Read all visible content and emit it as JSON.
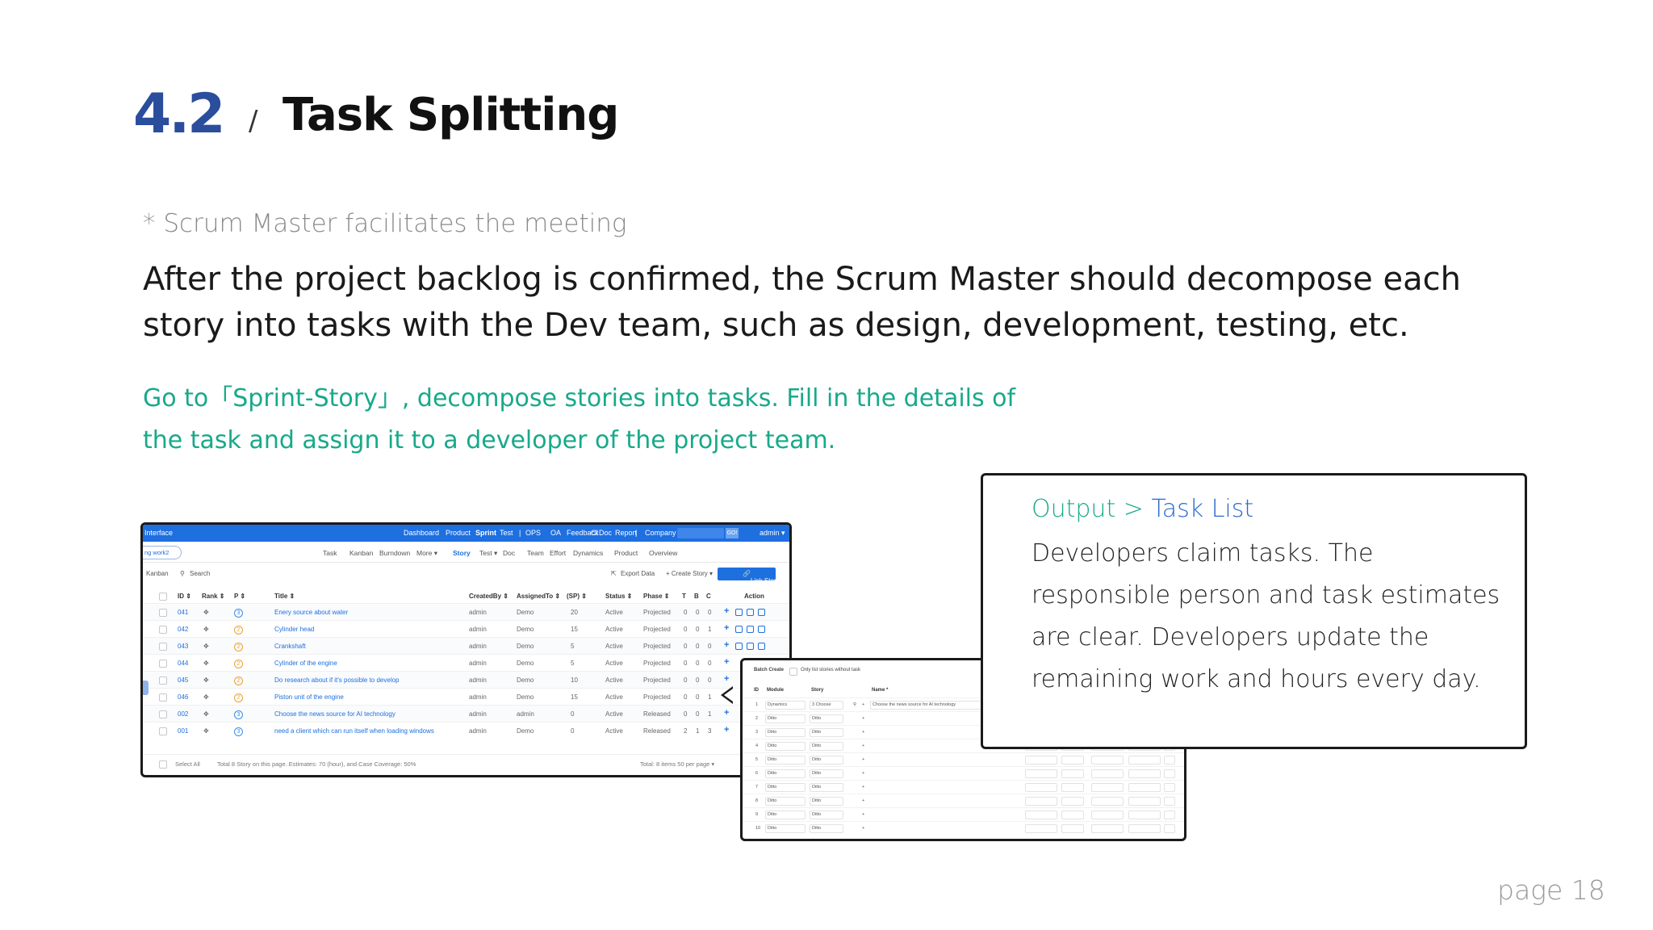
{
  "header": {
    "section_number": "4.2",
    "slash": "/",
    "title": "Task Splitting"
  },
  "note": "* Scrum Master facilitates the meeting",
  "lead": "After the project backlog is confirmed, the Scrum Master should decompose each story into tasks with the Dev team, such as design, development, testing, etc.",
  "instruction": "Go to「Sprint-Story」, decompose stories into tasks. Fill in the details of the task and assign it to a developer of the project team.",
  "callout": {
    "title_prefix": "Output >",
    "title_link": "Task List",
    "body": "Developers claim tasks. The responsible person and task estimates are clear. Developers update the remaining work and hours every day."
  },
  "page_number": "page 18",
  "app": {
    "topbar": {
      "brand": "Interface",
      "nav": [
        "Dashboard",
        "Product",
        "Sprint",
        "Test",
        "|",
        "OPS",
        "OA",
        "Feedback",
        "CI",
        "Doc",
        "Report",
        "|",
        "Company",
        "Admin"
      ],
      "go": "GO!",
      "user": "admin ▾"
    },
    "subnav": {
      "crumb": "ng work2",
      "items": [
        "Task",
        "Kanban",
        "Burndown",
        "More ▾",
        "Story",
        "Test ▾",
        "Doc",
        "Team",
        "Effort",
        "Dynamics",
        "Product",
        "Overview"
      ]
    },
    "toolbar": {
      "kanban": "Kanban",
      "search": "Search",
      "export": "Export Data",
      "create": "+ Create Story ▾",
      "link": "Link Story ▾"
    },
    "columns": [
      "ID ⇕",
      "Rank ⇕",
      "P ⇕",
      "Title ⇕",
      "CreatedBy ⇕",
      "AssignedTo ⇕",
      "(SP) ⇕",
      "Status ⇕",
      "Phase ⇕",
      "T",
      "B",
      "C",
      "Action"
    ],
    "rows": [
      {
        "id": "041",
        "p": "3",
        "title": "Enery source about water",
        "created": "admin",
        "assigned": "Demo",
        "sp": "20",
        "status": "Active",
        "phase": "Projected",
        "t": "0",
        "b": "0",
        "c": "0"
      },
      {
        "id": "042",
        "p": "2",
        "title": "Cylinder head",
        "created": "admin",
        "assigned": "Demo",
        "sp": "15",
        "status": "Active",
        "phase": "Projected",
        "t": "0",
        "b": "0",
        "c": "1"
      },
      {
        "id": "043",
        "p": "2",
        "title": "Crankshaft",
        "created": "admin",
        "assigned": "Demo",
        "sp": "5",
        "status": "Active",
        "phase": "Projected",
        "t": "0",
        "b": "0",
        "c": "0"
      },
      {
        "id": "044",
        "p": "2",
        "title": "Cylinder of the engine",
        "created": "admin",
        "assigned": "Demo",
        "sp": "5",
        "status": "Active",
        "phase": "Projected",
        "t": "0",
        "b": "0",
        "c": "0"
      },
      {
        "id": "045",
        "p": "2",
        "title": "Do research about if it's possible to develop",
        "created": "admin",
        "assigned": "Demo",
        "sp": "10",
        "status": "Active",
        "phase": "Projected",
        "t": "0",
        "b": "0",
        "c": "0"
      },
      {
        "id": "046",
        "p": "2",
        "title": "Piston unit of the engine",
        "created": "admin",
        "assigned": "Demo",
        "sp": "15",
        "status": "Active",
        "phase": "Projected",
        "t": "0",
        "b": "0",
        "c": "1"
      },
      {
        "id": "002",
        "p": "3",
        "title": "Choose the news source for AI technology",
        "created": "admin",
        "assigned": "admin",
        "sp": "0",
        "status": "Active",
        "phase": "Released",
        "t": "0",
        "b": "0",
        "c": "1"
      },
      {
        "id": "001",
        "p": "3",
        "title": "need a client which can run itself when loading windows",
        "created": "admin",
        "assigned": "Demo",
        "sp": "0",
        "status": "Active",
        "phase": "Released",
        "t": "2",
        "b": "1",
        "c": "3"
      }
    ],
    "footer": {
      "select_all": "Select All",
      "summary": "Total 8 Story on this page. Estimates: 70 (hour), and Case Coverage: 50%",
      "paging": "Total: 8 items   50 per page ▾"
    }
  },
  "batch": {
    "title": "Batch Create",
    "option": "Only list stories without task",
    "columns": [
      "ID",
      "Module",
      "Story",
      "Name *"
    ],
    "first_row": {
      "id": "1",
      "module": "Dynamics",
      "story": "3 Choose",
      "name": "Choose the news source for AI technology"
    },
    "ditto": "Ditto",
    "rows": [
      "2",
      "3",
      "4",
      "5",
      "6",
      "7",
      "8",
      "9",
      "10"
    ]
  }
}
